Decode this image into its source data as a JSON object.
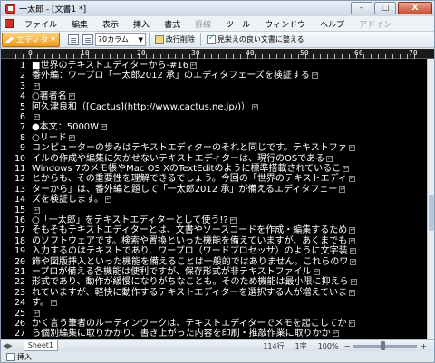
{
  "window": {
    "title": "一太郎 - [文書1 *]",
    "controls": {
      "minimize": "–",
      "maximize": "□",
      "close": "X"
    }
  },
  "menu": {
    "items": [
      {
        "label": "ファイル",
        "dim": false
      },
      {
        "label": "編集",
        "dim": false
      },
      {
        "label": "表示",
        "dim": false
      },
      {
        "label": "挿入",
        "dim": false
      },
      {
        "label": "書式",
        "dim": false
      },
      {
        "label": "罫線",
        "dim": true
      },
      {
        "label": "ツール",
        "dim": false
      },
      {
        "label": "ウィンドウ",
        "dim": false
      },
      {
        "label": "ヘルプ",
        "dim": false
      },
      {
        "label": "アドイン",
        "dim": true
      }
    ]
  },
  "toolbar": {
    "mode_label": "エディタ",
    "columns_value": "70カラム",
    "line_break_label": "改行削除",
    "format_label": "見栄えの良い文書に整える"
  },
  "ruler": {
    "numbers": [
      "0",
      "10",
      "20",
      "30",
      "40",
      "50",
      "60",
      "70"
    ]
  },
  "editor": {
    "lines": [
      {
        "num": "1",
        "text": "■世界のテキストエディターから-#16"
      },
      {
        "num": "2",
        "text": "番外編：ワープロ「一太郎2012 承」のエディタフェーズを検証する"
      },
      {
        "num": "3",
        "text": ""
      },
      {
        "num": "4",
        "text": "○著者名"
      },
      {
        "num": "5",
        "text": "阿久津良和（[Cactus](http://www.cactus.ne.jp/)）"
      },
      {
        "num": "6",
        "text": ""
      },
      {
        "num": "7",
        "text": "●本文：5000W"
      },
      {
        "num": "8",
        "text": "○リード"
      },
      {
        "num": "9",
        "text": "コンピューターの歩みはテキストエディターのそれと同じです。テキストファ"
      },
      {
        "num": "10",
        "text": "イルの作成や編集に欠かせないテキストエディターは、現行のOSである"
      },
      {
        "num": "11",
        "text": "Windows 7のメモ帳やMac OS XのTextEditのように標準搭載されているこ"
      },
      {
        "num": "12",
        "text": "とからも、その重要性を理解できるでしょう。今回の「世界のテキストエディ"
      },
      {
        "num": "13",
        "text": "ターから」は、番外編と題して「一太郎2012 承」が備えるエディタフェー"
      },
      {
        "num": "14",
        "text": "ズを検証します。"
      },
      {
        "num": "15",
        "text": ""
      },
      {
        "num": "16",
        "text": "○「一太郎」をテキストエディターとして使う!?"
      },
      {
        "num": "17",
        "text": "そもそもテキストエディターとは、文書やソースコードを作成・編集するため"
      },
      {
        "num": "18",
        "text": "のソフトウェアです。検索や置換といった機能を備えていますが、あくまでも"
      },
      {
        "num": "19",
        "text": "入力するのはテキストであり、ワープロ（ワードプロセッサ）のように文字装"
      },
      {
        "num": "20",
        "text": "飾や図版挿入といった機能を備えることは一般的ではありません。これらのワ"
      },
      {
        "num": "21",
        "text": "ープロが備える各機能は便利ですが、保存形式が非テキストファイル"
      },
      {
        "num": "22",
        "text": "形式であり、動作が緩慢になりがちなことも。そのため機能は最小限に抑えら"
      },
      {
        "num": "23",
        "text": "れていますが、軽快に動作するテキストエディターを選択する人が増えていま"
      },
      {
        "num": "24",
        "text": "す。"
      },
      {
        "num": "25",
        "text": ""
      },
      {
        "num": "26",
        "text": "かく言う筆者のルーティンワークは、テキストエディターでメモを起こしてか"
      },
      {
        "num": "27",
        "text": "ら個別編集に取りかかり、書き上がった内容を印刷・推敲作業に取りかか"
      }
    ]
  },
  "status": {
    "sheet_label": "Sheet1",
    "line_pos": "114行",
    "col_pos": "1字",
    "zoom": "100%",
    "insert_label": "挿入"
  }
}
